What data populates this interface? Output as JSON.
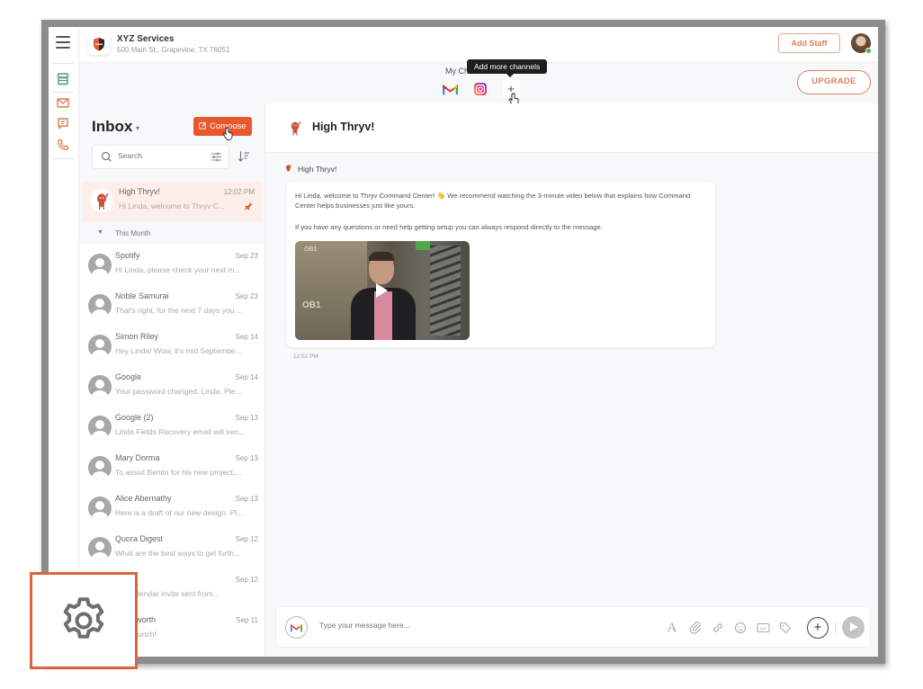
{
  "header": {
    "business_name": "XYZ Services",
    "business_address": "500 Main St., Grapevine, TX 76051",
    "add_staff_label": "Add Staff",
    "upgrade_label": "UPGRADE"
  },
  "rail": {
    "icons": [
      "menu-icon",
      "store-icon",
      "mail-icon",
      "chat-icon",
      "phone-icon"
    ]
  },
  "channels": {
    "label": "My Ch",
    "tooltip": "Add more channels",
    "items": [
      "gmail",
      "instagram"
    ],
    "add_label": "+"
  },
  "inbox": {
    "title": "Inbox",
    "compose_label": "Compose",
    "search_placeholder": "Search",
    "pinned": {
      "name": "High Thryv!",
      "time": "12:02 PM",
      "preview": "Hi Linda, welcome to Thryv C..."
    },
    "section_label": "This Month",
    "messages": [
      {
        "name": "Spotify",
        "date": "Sep 23",
        "preview": "Hi Linda, please check your next m..."
      },
      {
        "name": "Noble Samurai",
        "date": "Sep 23",
        "preview": "That's right, for the next 7 days you ..."
      },
      {
        "name": "Simon Riley",
        "date": "Sep 14",
        "preview": "Hey Linda! Wow, it's mid Septembe..."
      },
      {
        "name": "Google",
        "date": "Sep 14",
        "preview": "Your password changed, Linda. Ple..."
      },
      {
        "name": "Google (2)",
        "date": "Sep 13",
        "preview": "Linda Fields Recovery email will sen..."
      },
      {
        "name": "Mary Dorma",
        "date": "Sep 13",
        "preview": "To assist Benito for his new project,..."
      },
      {
        "name": "Alice Abernathy",
        "date": "Sep 13",
        "preview": "Here is a draft of our new design. Pl..."
      },
      {
        "name": "Quora Digest",
        "date": "Sep 12",
        "preview": "What are the best ways to get furth..."
      },
      {
        "name": "",
        "date": "Sep 12",
        "preview": "test calendar invite sent from..."
      },
      {
        "name": "Farnsworth",
        "date": "Sep 11",
        "preview": "ion to lunch!"
      }
    ]
  },
  "conversation": {
    "title": "High Thryv!",
    "sender": "High Thryv!",
    "body_line1": "Hi Linda, welcome to Thryv Command Center! 👋 We recommend watching the 3-minute video below that explains how Command Center helps businesses just like yours.",
    "body_line2": "If you have any questions or need help getting setup you can always respond directly to the message.",
    "video_text_1": "OB1",
    "video_text_2": "OB1",
    "time": "12:02 PM"
  },
  "composer": {
    "placeholder": "Type your message here...",
    "tools": [
      "text-format-icon",
      "attach-icon",
      "link-icon",
      "emoji-icon",
      "gif-icon",
      "tag-icon"
    ]
  },
  "callout": {
    "icon": "gear-icon"
  },
  "colors": {
    "accent": "#e8582c",
    "accent_outline": "#d9825b",
    "callout_border": "#d9653f"
  }
}
